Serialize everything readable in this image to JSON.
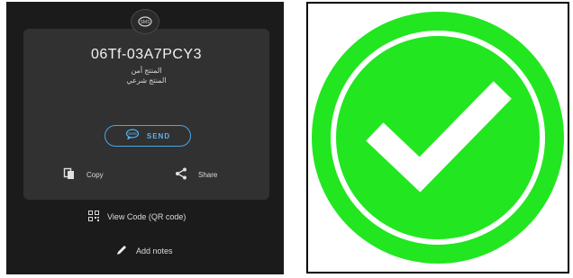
{
  "sms_screen": {
    "badge_icon": "sms-icon",
    "code": "06Tf-03A7PCY3",
    "status_lines": [
      "المنتج أمن",
      "المنتج شرعي"
    ],
    "send_button": {
      "icon": "sms-bubble-icon",
      "label": "SEND",
      "accent_color": "#58b2f0"
    },
    "actions": {
      "copy": {
        "icon": "copy-icon",
        "label": "Copy"
      },
      "share": {
        "icon": "share-icon",
        "label": "Share"
      }
    },
    "view_qr": {
      "icon": "qr-code-icon",
      "label": "View Code (QR code)"
    },
    "add_notes": {
      "icon": "pencil-icon",
      "label": "Add notes"
    }
  },
  "check_tile": {
    "icon": "check-circle-icon",
    "accent_color": "#22e620"
  }
}
